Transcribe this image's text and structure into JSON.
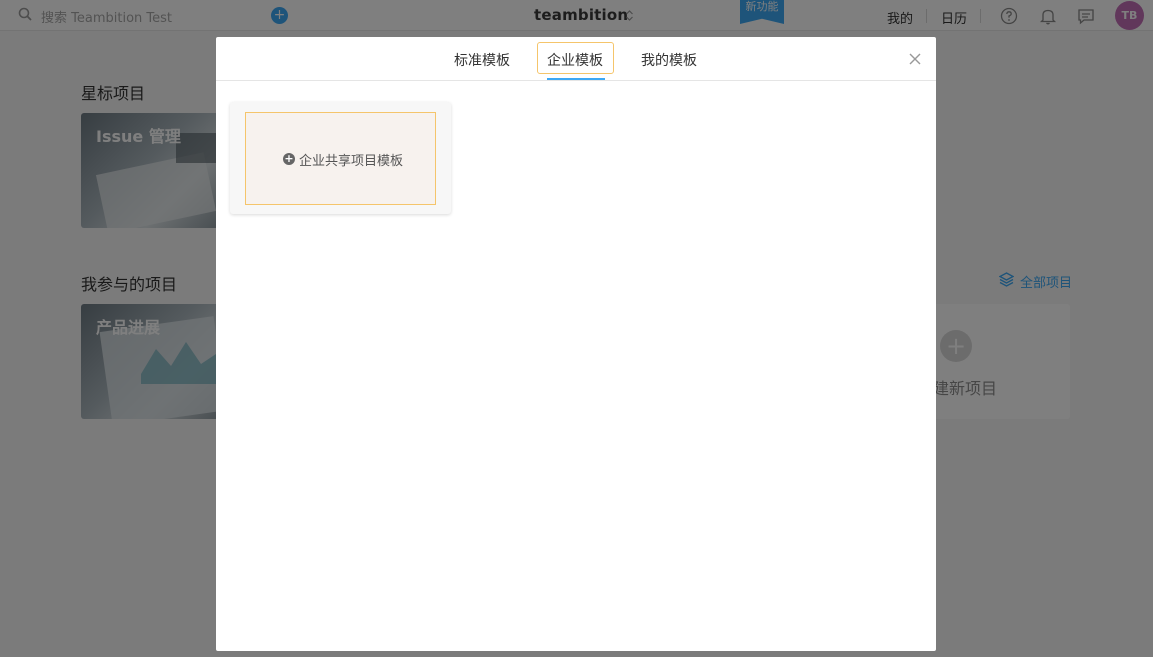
{
  "app": {
    "search_placeholder": "搜索 Teambition Test",
    "plus_glyph": "+",
    "logo": "teambition",
    "new_feature_badge": "新功能",
    "nav": {
      "mine": "我的",
      "calendar": "日历"
    },
    "avatar_initials": "TB",
    "icons": [
      "search-icon",
      "add-circle-icon",
      "chevron-updown-icon",
      "help-icon",
      "bell-icon",
      "message-icon",
      "layers-icon"
    ]
  },
  "background": {
    "starred_title": "星标项目",
    "starred_projects": [
      {
        "name": "Issue 管理"
      }
    ],
    "joined_title": "我参与的项目",
    "joined_projects": [
      {
        "name": "产品进展"
      }
    ],
    "all_projects_link": "全部项目",
    "new_project_label": "建新项目",
    "new_project_plus": "+"
  },
  "modal": {
    "tabs": [
      {
        "label": "标准模板",
        "active": false
      },
      {
        "label": "企业模板",
        "active": true
      },
      {
        "label": "我的模板",
        "active": false
      }
    ],
    "template_card": {
      "plus_glyph": "+",
      "label": "企业共享项目模板"
    }
  },
  "colors": {
    "accent": "#3da8f5",
    "active_border": "#f5c56b",
    "avatar": "#c36eb6"
  }
}
